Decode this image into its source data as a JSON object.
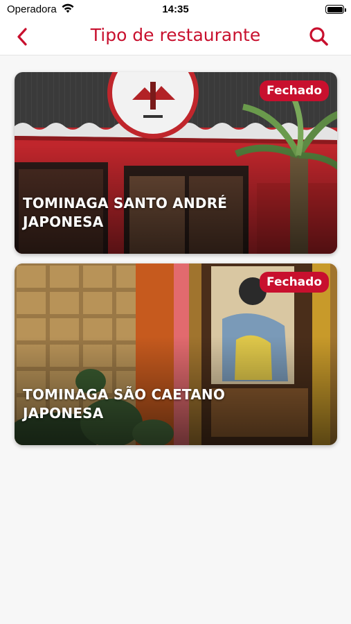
{
  "status_bar": {
    "carrier": "Operadora",
    "time": "14:35"
  },
  "header": {
    "title": "Tipo de restaurante",
    "back_icon": "chevron-left-icon",
    "search_icon": "search-icon"
  },
  "colors": {
    "accent": "#c8102e",
    "background": "#f7f7f7"
  },
  "restaurants": [
    {
      "name": "TOMINAGA SANTO ANDRÉ",
      "type": "JAPONESA",
      "status": "Fechado"
    },
    {
      "name": "TOMINAGA SÃO CAETANO",
      "type": "JAPONESA",
      "status": "Fechado"
    }
  ]
}
